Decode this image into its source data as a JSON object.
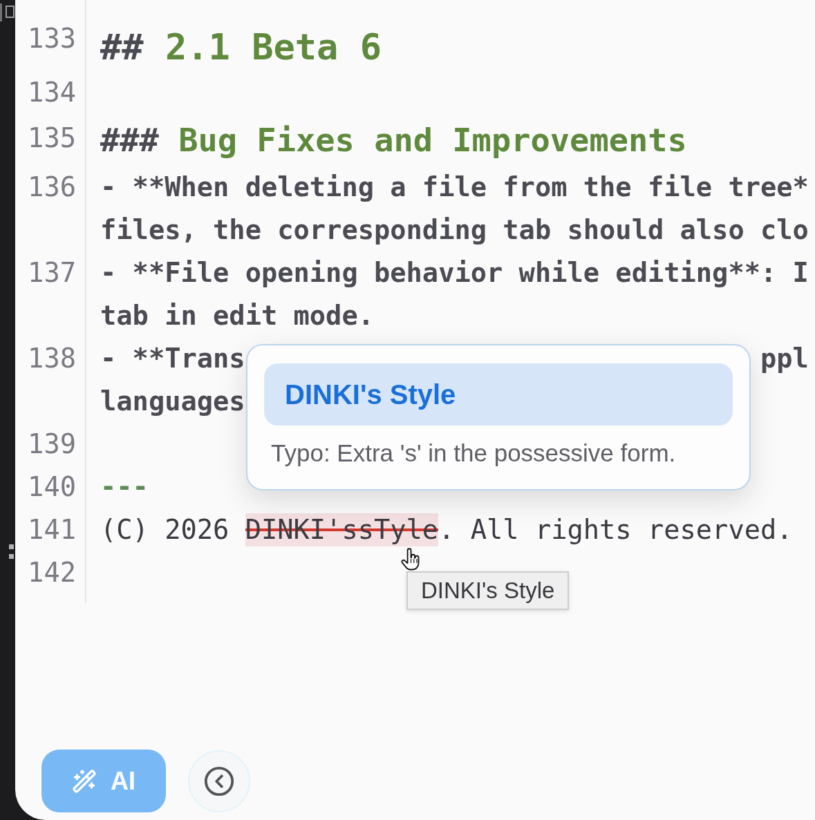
{
  "editor": {
    "lines": [
      {
        "number": "133",
        "kind": "h2",
        "marker": "##",
        "text": "2.1 Beta 6"
      },
      {
        "number": "134",
        "kind": "blank"
      },
      {
        "number": "135",
        "kind": "h3",
        "marker": "###",
        "text": "Bug Fixes and Improvements"
      },
      {
        "number": "136",
        "kind": "bold",
        "rows": [
          "- **When deleting a file from the file tree*",
          "files, the corresponding tab should also clo"
        ]
      },
      {
        "number": "137",
        "kind": "bold",
        "rows": [
          "- **File opening behavior while editing**: I",
          "tab in edit mode."
        ]
      },
      {
        "number": "138",
        "kind": "bold",
        "rows": [
          "- **Trans",
          "languages"
        ],
        "fragment": "ppl"
      },
      {
        "number": "139",
        "kind": "blank"
      },
      {
        "number": "140",
        "kind": "rule",
        "text": "---"
      },
      {
        "number": "141",
        "kind": "plain",
        "before": "(C) 2026 ",
        "misspelling": "DINKI'ssTyle",
        "after": ". All rights reserved."
      },
      {
        "number": "142",
        "kind": "blank"
      }
    ]
  },
  "suggestion_popup": {
    "suggestions": [
      {
        "label": "DINKI's Style",
        "selected": true
      }
    ],
    "note": "Typo: Extra 's' in the possessive form."
  },
  "tooltip": {
    "text": "DINKI's Style"
  },
  "toolbar": {
    "ai_button": "AI"
  }
}
